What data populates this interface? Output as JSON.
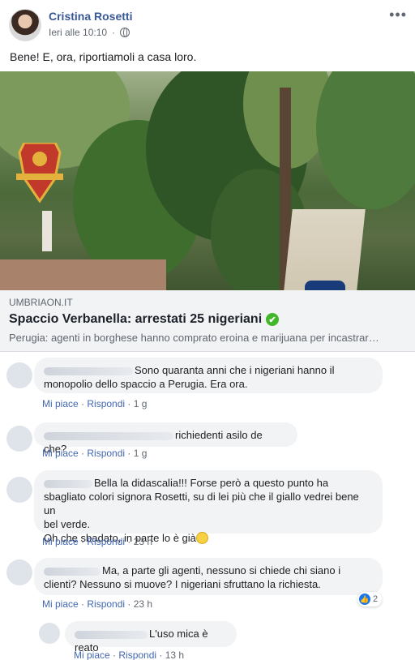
{
  "post": {
    "author": "Cristina Rosetti",
    "timestamp": "Ieri alle 10:10",
    "text": "Bene! E, ora, riportiamoli a casa loro."
  },
  "link": {
    "domain": "UMBRIAON.IT",
    "title": "Spaccio Verbanella: arrestati 25 nigeriani",
    "description": "Perugia: agenti in borghese hanno comprato eroina e marijuana per incastrar…"
  },
  "actions": {
    "like": "Mi piace",
    "reply": "Rispondi"
  },
  "comments": [
    {
      "text_line1": "Sono quaranta anni che i nigeriani hanno il",
      "text_line2": "monopolio dello spaccio a Perugia. Era ora.",
      "time": "1 g"
    },
    {
      "text_line1": "richiedenti asilo de che?",
      "time": "1 g"
    },
    {
      "text_line1": "Bella la didascalia!!! Forse però a questo punto ha",
      "text_line2": "sbagliato colori signora Rosetti, su di lei più che il giallo vedrei bene un",
      "text_line3": "bel verde.",
      "text_line4": "Oh che sbadato, in parte lo è già",
      "time": "23 h"
    },
    {
      "text_line1": "Ma, a parte gli agenti, nessuno si chiede chi siano i",
      "text_line2": "clienti? Nessuno si muove? I nigeriani sfruttano la richiesta.",
      "time": "23 h",
      "reactions": "2"
    },
    {
      "text_line1": "L'uso mica è reato",
      "time": "13 h"
    }
  ]
}
